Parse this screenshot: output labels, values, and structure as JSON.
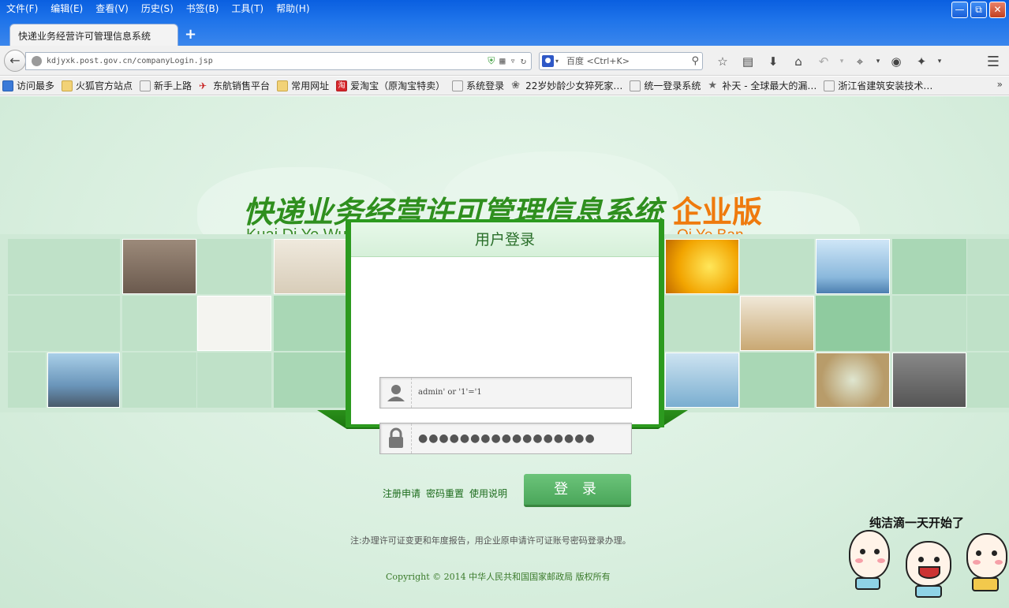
{
  "browser": {
    "menu": [
      "文件(F)",
      "编辑(E)",
      "查看(V)",
      "历史(S)",
      "书签(B)",
      "工具(T)",
      "帮助(H)"
    ],
    "tab_title": "快递业务经营许可管理信息系统",
    "url": "kdjyxk.post.gov.cn/companyLogin.jsp",
    "search_engine": "百度",
    "search_placeholder": "百度 <Ctrl+K>",
    "bookmarks": [
      {
        "label": "访问最多",
        "icon": "star"
      },
      {
        "label": "火狐官方站点",
        "icon": "folder"
      },
      {
        "label": "新手上路",
        "icon": "page"
      },
      {
        "label": "东航销售平台",
        "icon": "plane"
      },
      {
        "label": "常用网址",
        "icon": "folder"
      },
      {
        "label": "爱淘宝（原淘宝特卖）",
        "icon": "red"
      },
      {
        "label": "系统登录",
        "icon": "page"
      },
      {
        "label": "22岁妙龄少女猝死家…",
        "icon": "blue"
      },
      {
        "label": "统一登录系统",
        "icon": "page"
      },
      {
        "label": "补天 - 全球最大的漏…",
        "icon": "star"
      },
      {
        "label": "浙江省建筑安装技术…",
        "icon": "page"
      }
    ]
  },
  "page": {
    "title": "快递业务经营许可管理信息系统",
    "title_pinyin": "Kuai Di Ye Wu Jing Ying Xu Ke Guan Li Xin Xi Xi Tong",
    "edition": "企业版",
    "edition_pinyin": "Qi Ye Ban",
    "login": {
      "header": "用户登录",
      "username_value": "admin' or '1'='1",
      "password_mask": "●●●●●●●●●●●●●●●●●",
      "links": [
        "注册申请",
        "密码重置",
        "使用说明"
      ],
      "submit_label": "登 录"
    },
    "note": "注:办理许可证变更和年度报告，用企业原申请许可证账号密码登录办理。",
    "copyright": "Copyright © 2014 中华人民共和国国家邮政局 版权所有",
    "slogan": "纯洁滴一天开始了"
  },
  "colors": {
    "brand_green": "#2f8f1e",
    "edition_orange": "#ef7a0d",
    "button_green": "#5cb86a",
    "titlebar_blue": "#1f74ea"
  }
}
